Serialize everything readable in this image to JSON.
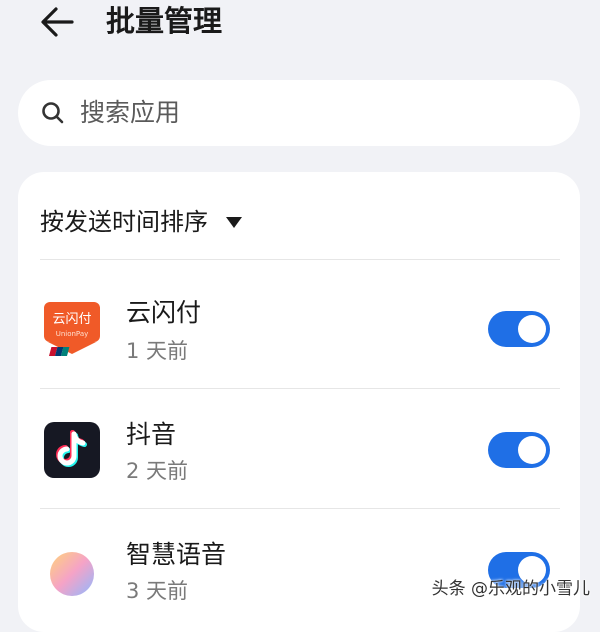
{
  "header": {
    "title": "批量管理",
    "back_icon": "arrow-left-icon"
  },
  "search": {
    "placeholder": "搜索应用",
    "icon": "search-icon"
  },
  "sort": {
    "label": "按发送时间排序",
    "icon": "caret-down-icon"
  },
  "apps": [
    {
      "name": "云闪付",
      "time": "1 天前",
      "enabled": true,
      "icon": "unionpay-app-icon",
      "icon_text": "云闪付",
      "icon_subtext": "UnionPay"
    },
    {
      "name": "抖音",
      "time": "2 天前",
      "enabled": true,
      "icon": "douyin-app-icon"
    },
    {
      "name": "智慧语音",
      "time": "3 天前",
      "enabled": true,
      "icon": "smart-voice-app-icon"
    }
  ],
  "colors": {
    "background": "#f1f2f6",
    "accent": "#1f6fe6",
    "unionpay_orange": "#f05a28"
  },
  "watermark": "头条 @乐观的小雪儿"
}
